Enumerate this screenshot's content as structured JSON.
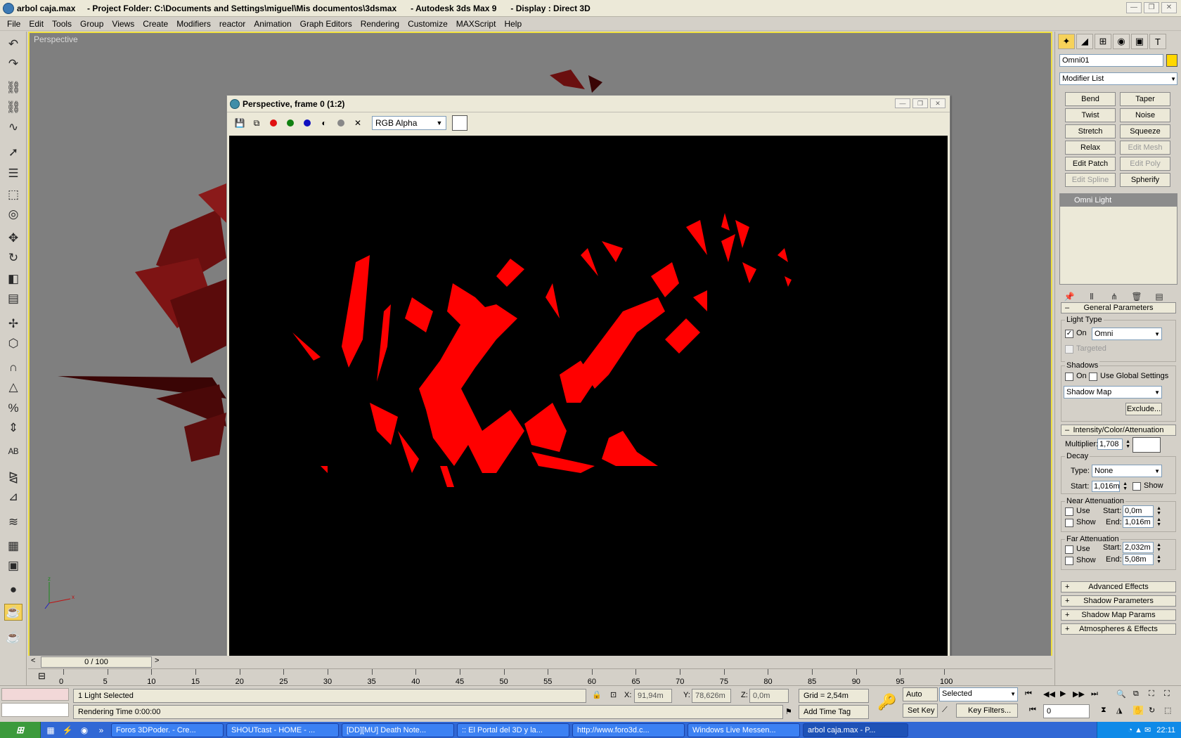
{
  "window": {
    "title": "arbol caja.max     - Project Folder: C:\\Documents and Settings\\miguel\\Mis documentos\\3dsmax      - Autodesk 3ds Max 9      - Display : Direct 3D"
  },
  "menu": [
    "File",
    "Edit",
    "Tools",
    "Group",
    "Views",
    "Create",
    "Modifiers",
    "reactor",
    "Animation",
    "Graph Editors",
    "Rendering",
    "Customize",
    "MAXScript",
    "Help"
  ],
  "viewport": {
    "label": "Perspective"
  },
  "render_window": {
    "title": "Perspective, frame 0 (1:2)",
    "channel": "RGB Alpha"
  },
  "command_panel": {
    "object_name": "Omni01",
    "object_color": "#ffd800",
    "modifier_list": "Modifier List",
    "modifier_buttons": [
      {
        "label": "Bend",
        "enabled": true
      },
      {
        "label": "Taper",
        "enabled": true
      },
      {
        "label": "Twist",
        "enabled": true
      },
      {
        "label": "Noise",
        "enabled": true
      },
      {
        "label": "Stretch",
        "enabled": true
      },
      {
        "label": "Squeeze",
        "enabled": true
      },
      {
        "label": "Relax",
        "enabled": true
      },
      {
        "label": "Edit Mesh",
        "enabled": false
      },
      {
        "label": "Edit Patch",
        "enabled": true
      },
      {
        "label": "Edit Poly",
        "enabled": false
      },
      {
        "label": "Edit Spline",
        "enabled": false
      },
      {
        "label": "Spherify",
        "enabled": true
      }
    ],
    "stack_item": "Omni Light",
    "general": {
      "header": "General Parameters",
      "light_type_label": "Light Type",
      "on_label": "On",
      "light_type": "Omni",
      "targeted_label": "Targeted",
      "shadows_label": "Shadows",
      "shadows_on_label": "On",
      "use_global_label": "Use Global Settings",
      "shadow_type": "Shadow Map",
      "exclude_label": "Exclude..."
    },
    "intensity": {
      "header": "Intensity/Color/Attenuation",
      "multiplier_label": "Multiplier:",
      "multiplier": "1,708",
      "decay_label": "Decay",
      "type_label": "Type:",
      "decay_type": "None",
      "start_label": "Start:",
      "decay_start": "1,016m",
      "show_label": "Show",
      "near_label": "Near Attenuation",
      "use_label": "Use",
      "near_start": "0,0m",
      "end_label": "End:",
      "near_end": "1,016m",
      "far_label": "Far Attenuation",
      "far_start": "2,032m",
      "far_end": "5,08m"
    },
    "rollouts": [
      "Advanced Effects",
      "Shadow Parameters",
      "Shadow Map Params",
      "Atmospheres & Effects"
    ]
  },
  "timeline": {
    "slider": "0 / 100",
    "ticks": [
      "0",
      "5",
      "10",
      "15",
      "20",
      "25",
      "30",
      "35",
      "40",
      "45",
      "50",
      "55",
      "60",
      "65",
      "70",
      "75",
      "80",
      "85",
      "90",
      "95",
      "100"
    ]
  },
  "status": {
    "selection": "1 Light Selected",
    "render_time": "Rendering Time  0:00:00",
    "x_label": "X:",
    "x_value": "91,94m",
    "y_label": "Y:",
    "y_value": "78,626m",
    "z_label": "Z:",
    "z_value": "0,0m",
    "grid": "Grid = 2,54m",
    "add_time_tag": "Add Time Tag",
    "auto_key": "Auto Key",
    "set_key": "Set Key",
    "selected": "Selected",
    "key_filters": "Key Filters...",
    "frame": "0"
  },
  "taskbar": {
    "items": [
      {
        "label": "Foros 3DPoder. - Cre..."
      },
      {
        "label": "SHOUTcast - HOME - ..."
      },
      {
        "label": "[DD][MU] Death Note..."
      },
      {
        "label": ":: El Portal del 3D y la..."
      },
      {
        "label": "http://www.foro3d.c..."
      },
      {
        "label": "Windows Live Messen..."
      },
      {
        "label": "arbol caja.max   - P..."
      }
    ],
    "clock": "22:11"
  }
}
